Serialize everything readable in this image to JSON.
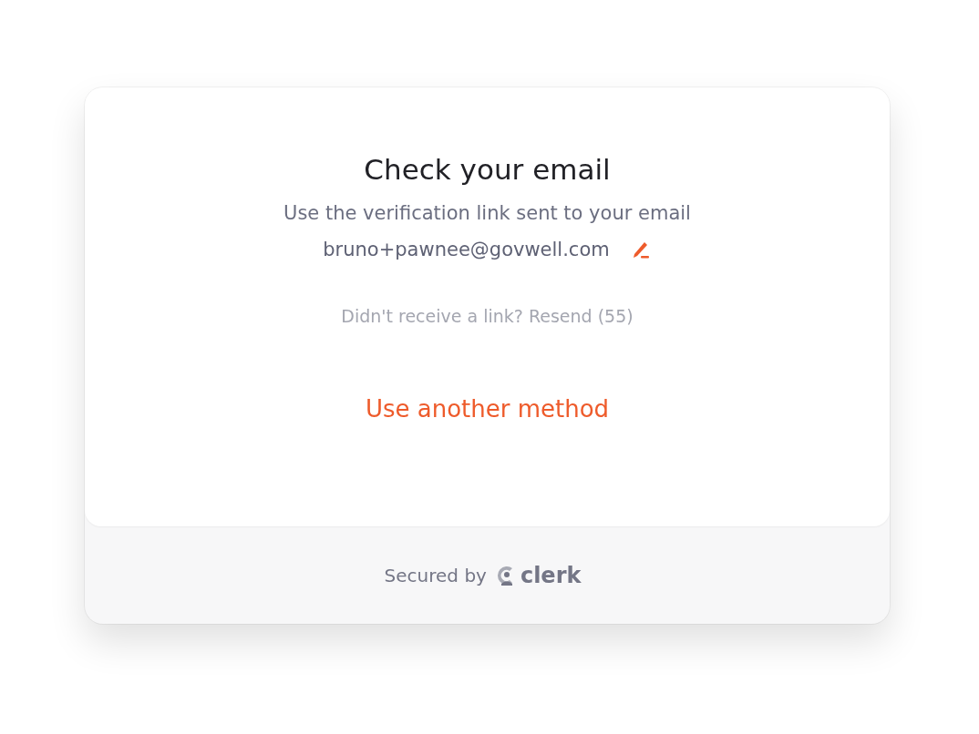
{
  "card": {
    "title": "Check your email",
    "subtitle": "Use the verification link sent to your email",
    "email": "bruno+pawnee@govwell.com",
    "resend": {
      "text": "Didn't receive a link? Resend (55)",
      "disabled": true
    },
    "alternate_link": "Use another method"
  },
  "footer": {
    "secured_by": "Secured by",
    "brand": "clerk"
  }
}
